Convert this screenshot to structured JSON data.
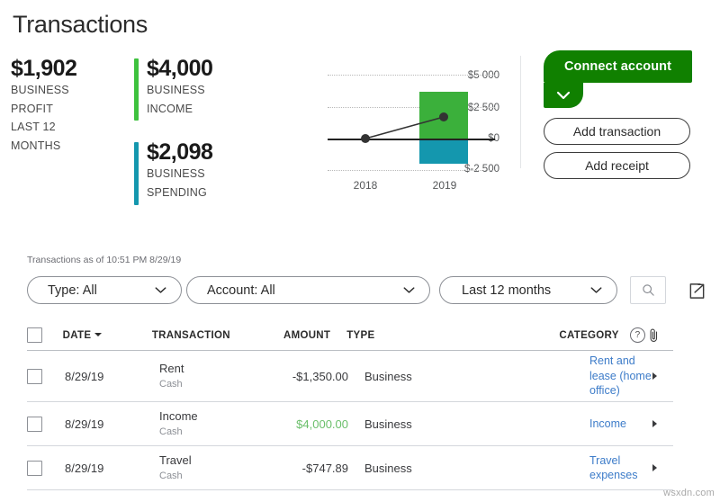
{
  "page_title": "Transactions",
  "summary": {
    "profit": {
      "amount": "$1,902",
      "label": "BUSINESS\nPROFIT\nLAST 12\nMONTHS",
      "lines": [
        "BUSINESS",
        "PROFIT",
        "LAST 12",
        "MONTHS"
      ]
    },
    "income": {
      "amount": "$4,000",
      "lines": [
        "BUSINESS",
        "INCOME"
      ],
      "accent_color": "#3ec23e"
    },
    "spending": {
      "amount": "$2,098",
      "lines": [
        "BUSINESS",
        "SPENDING"
      ],
      "accent_color": "#1497ae"
    }
  },
  "chart_data": {
    "type": "bar",
    "title": "",
    "xlabel": "",
    "ylabel": "",
    "categories": [
      "2018",
      "2019"
    ],
    "ytick_labels": [
      "$5 000",
      "$2 500",
      "$0",
      "$-2 500"
    ],
    "ytick_values": [
      5000,
      2500,
      0,
      -2500
    ],
    "ylim": [
      -2500,
      5000
    ],
    "grid": "dotted-horizontal",
    "legend": "none",
    "series": [
      {
        "name": "Business income",
        "type": "bar",
        "color": "#3bb03b",
        "values": [
          0,
          4000
        ]
      },
      {
        "name": "Business spending",
        "type": "bar",
        "color": "#1497ae",
        "values": [
          0,
          -2098
        ]
      },
      {
        "name": "Business profit",
        "type": "line",
        "color": "#333333",
        "values": [
          0,
          1902
        ]
      }
    ]
  },
  "actions": {
    "connect_account": "Connect account",
    "connect_account_dropdown_icon": "chevron-down-icon",
    "add_transaction": "Add transaction",
    "add_receipt": "Add receipt"
  },
  "filters": {
    "as_of": "Transactions as of 10:51 PM 8/29/19",
    "type": {
      "label": "Type: All"
    },
    "account": {
      "label": "Account: All"
    },
    "date_range": {
      "label": "Last 12 months"
    },
    "search_icon": "search-icon",
    "export_icon": "export-icon"
  },
  "table": {
    "headers": {
      "date": "DATE",
      "transaction": "TRANSACTION",
      "amount": "AMOUNT",
      "type": "TYPE",
      "category": "CATEGORY",
      "category_help": "?",
      "attachment_icon": "paperclip-icon"
    },
    "rows": [
      {
        "date": "8/29/19",
        "transaction": "Rent",
        "account": "Cash",
        "amount": "-$1,350.00",
        "amount_sign": "negative",
        "type": "Business",
        "category": "Rent and lease (home office)"
      },
      {
        "date": "8/29/19",
        "transaction": "Income",
        "account": "Cash",
        "amount": "$4,000.00",
        "amount_sign": "positive",
        "type": "Business",
        "category": "Income"
      },
      {
        "date": "8/29/19",
        "transaction": "Travel",
        "account": "Cash",
        "amount": "-$747.89",
        "amount_sign": "negative",
        "type": "Business",
        "category": "Travel expenses"
      }
    ]
  },
  "watermark": "wsxdn.com",
  "colors": {
    "brand_green": "#108000",
    "income_green": "#3bb03b",
    "spending_teal": "#1497ae",
    "link_blue": "#3d7cc9",
    "positive_amount": "#6bbf6b"
  }
}
